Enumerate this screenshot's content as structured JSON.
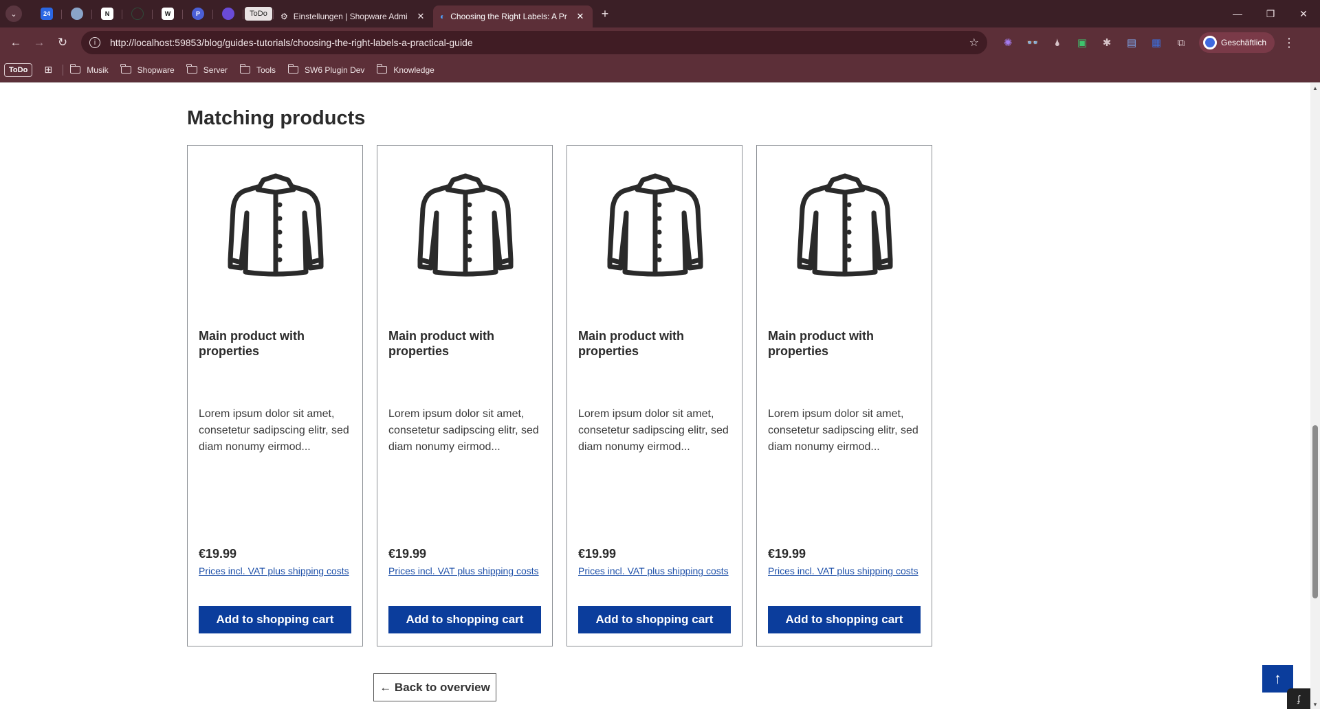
{
  "browser": {
    "pinned_tabs": [
      {
        "icon": "calendar-24-icon",
        "label": "24",
        "color": "#2b67e4"
      },
      {
        "icon": "cube-icon",
        "label": "",
        "color": "#8aa4c8"
      },
      {
        "icon": "notion-icon",
        "label": "N",
        "color": "#111111"
      },
      {
        "icon": "github-icon",
        "label": "",
        "color": "#2b2b2b"
      },
      {
        "icon": "w-icon",
        "label": "W",
        "color": "#111111"
      },
      {
        "icon": "circle-p-icon",
        "label": "P",
        "color": "#4b5fd6"
      },
      {
        "icon": "purple-orb-icon",
        "label": "",
        "color": "#6a4bd6"
      },
      {
        "icon": "todo-icon",
        "label": "ToDo",
        "color": "#e9e3e4"
      }
    ],
    "tabs": [
      {
        "title": "Einstellungen | Shopware Admi",
        "active": false
      },
      {
        "title": "Choosing the Right Labels: A Pr",
        "active": true
      }
    ],
    "address_url": "http://localhost:59853/blog/guides-tutorials/choosing-the-right-labels-a-practical-guide",
    "profile_label": "Geschäftlich",
    "bookmarks": {
      "todo_label": "ToDo",
      "folders": [
        "Musik",
        "Shopware",
        "Server",
        "Tools",
        "SW6 Plugin Dev",
        "Knowledge"
      ]
    }
  },
  "page": {
    "section_title": "Matching products",
    "products": [
      {
        "name": "Main product with properties",
        "description": "Lorem ipsum dolor sit amet, consetetur sadipscing elitr, sed diam nonumy eirmod...",
        "price": "€19.99",
        "vat_note": "Prices incl. VAT plus shipping costs",
        "button_label": "Add to shopping cart"
      },
      {
        "name": "Main product with properties",
        "description": "Lorem ipsum dolor sit amet, consetetur sadipscing elitr, sed diam nonumy eirmod...",
        "price": "€19.99",
        "vat_note": "Prices incl. VAT plus shipping costs",
        "button_label": "Add to shopping cart"
      },
      {
        "name": "Main product with properties",
        "description": "Lorem ipsum dolor sit amet, consetetur sadipscing elitr, sed diam nonumy eirmod...",
        "price": "€19.99",
        "vat_note": "Prices incl. VAT plus shipping costs",
        "button_label": "Add to shopping cart"
      },
      {
        "name": "Main product with properties",
        "description": "Lorem ipsum dolor sit amet, consetetur sadipscing elitr, sed diam nonumy eirmod...",
        "price": "€19.99",
        "vat_note": "Prices incl. VAT plus shipping costs",
        "button_label": "Add to shopping cart"
      }
    ],
    "back_label": "← Back to overview"
  },
  "colors": {
    "primary": "#0b3d9c",
    "link": "#1d4fa8",
    "chrome_dark": "#3b1f26",
    "chrome_toolbar": "#5c2f38"
  }
}
